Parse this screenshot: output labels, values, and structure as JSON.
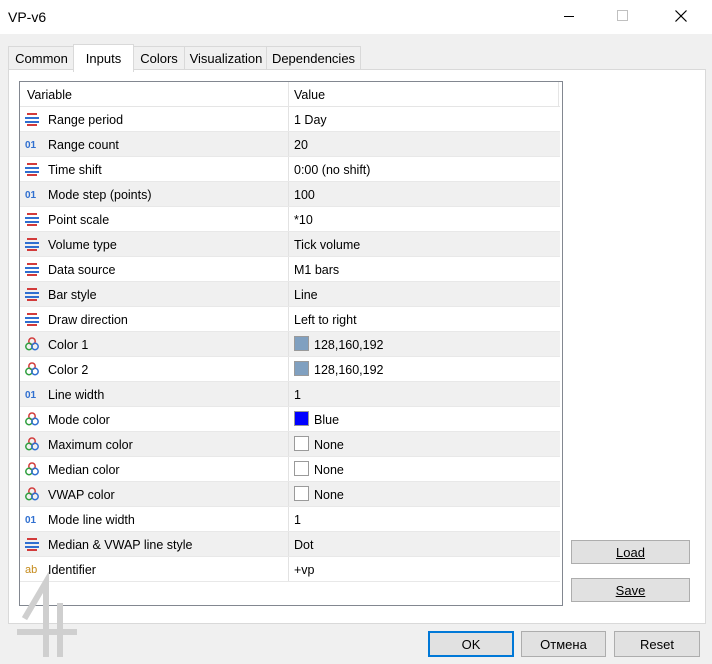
{
  "window": {
    "title": "VP-v6"
  },
  "tabs": [
    "Common",
    "Inputs",
    "Colors",
    "Visualization",
    "Dependencies"
  ],
  "active_tab": "Inputs",
  "grid": {
    "headers": {
      "variable": "Variable",
      "value": "Value"
    },
    "rows": [
      {
        "icon": "enum-icon",
        "variable": "Range period",
        "value": "1 Day"
      },
      {
        "icon": "integer-icon",
        "variable": "Range count",
        "value": "20"
      },
      {
        "icon": "enum-icon",
        "variable": "Time shift",
        "value": "0:00 (no shift)"
      },
      {
        "icon": "integer-icon",
        "variable": "Mode step (points)",
        "value": "100"
      },
      {
        "icon": "enum-icon",
        "variable": "Point scale",
        "value": "*10"
      },
      {
        "icon": "enum-icon",
        "variable": "Volume type",
        "value": "Tick volume"
      },
      {
        "icon": "enum-icon",
        "variable": "Data source",
        "value": "M1 bars"
      },
      {
        "icon": "enum-icon",
        "variable": "Bar style",
        "value": "Line"
      },
      {
        "icon": "enum-icon",
        "variable": "Draw direction",
        "value": "Left to right"
      },
      {
        "icon": "color-icon",
        "variable": "Color 1",
        "value": "128,160,192",
        "swatch": "#80a0c0"
      },
      {
        "icon": "color-icon",
        "variable": "Color 2",
        "value": "128,160,192",
        "swatch": "#80a0c0"
      },
      {
        "icon": "integer-icon",
        "variable": "Line width",
        "value": "1"
      },
      {
        "icon": "color-icon",
        "variable": "Mode color",
        "value": "Blue",
        "swatch": "#0000ff"
      },
      {
        "icon": "color-icon",
        "variable": "Maximum color",
        "value": "None",
        "swatch": "#ffffff"
      },
      {
        "icon": "color-icon",
        "variable": "Median color",
        "value": "None",
        "swatch": "#ffffff"
      },
      {
        "icon": "color-icon",
        "variable": "VWAP color",
        "value": "None",
        "swatch": "#ffffff"
      },
      {
        "icon": "integer-icon",
        "variable": "Mode line width",
        "value": "1"
      },
      {
        "icon": "enum-icon",
        "variable": "Median & VWAP line style",
        "value": "Dot"
      },
      {
        "icon": "string-icon",
        "variable": "Identifier",
        "value": "+vp"
      }
    ]
  },
  "side_buttons": {
    "load": "Load",
    "save": "Save"
  },
  "footer_buttons": {
    "ok": "OK",
    "cancel": "Отмена",
    "reset": "Reset"
  },
  "colors": {
    "accent": "#0078d7",
    "alt_row": "#f0f0f0"
  }
}
